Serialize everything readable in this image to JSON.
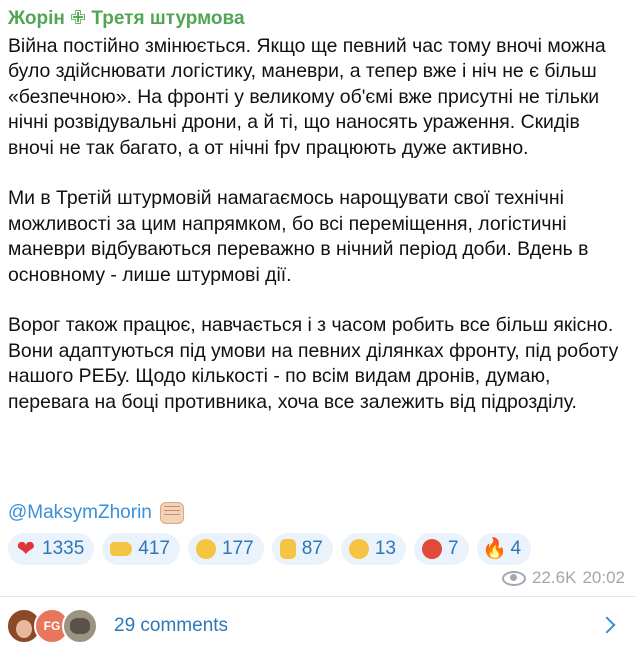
{
  "post": {
    "channel": "Жорін ✙ Третя штурмова",
    "paragraphs": [
      "Війна постійно змінюється. Якщо ще певний час тому вночі можна було здійснювати логістику, маневри, а тепер вже і ніч не є більш «безпечною». На фронті у великому об'ємі вже присутні не тільки нічні розвідувальні дрони, а й ті, що наносять ураження. Скидів вночі не так багато, а от нічні fpv працюють дуже активно.",
      "Ми в Третій штурмовій намагаємось нарощувати свої технічні можливості за цим напрямком, бо всі переміщення, логістичні маневри відбуваються переважно в нічний період доби. Вдень в основному - лише штурмові дії.",
      "Ворог також працює, навчається і з часом робить все більш якісно. Вони адаптуються під умови на певних ділянках фронту, під роботу нашого РЕБу. Щодо кількості - по всім видам дронів, думаю, перевага на боці противника, хоча все залежить від підрозділу."
    ],
    "signature": "@MaksymZhorin",
    "signature_icon": "fist-emoji-icon"
  },
  "reactions": [
    {
      "icon": "heart-emoji-icon",
      "glyph": "❤",
      "count": "1335"
    },
    {
      "icon": "pointing-hand-emoji-icon",
      "glyph": "",
      "count": "417"
    },
    {
      "icon": "crying-face-emoji-icon",
      "glyph": "",
      "count": "177"
    },
    {
      "icon": "thumbs-up-emoji-icon",
      "glyph": "",
      "count": "87"
    },
    {
      "icon": "grinning-face-emoji-icon",
      "glyph": "",
      "count": "13"
    },
    {
      "icon": "angry-face-emoji-icon",
      "glyph": "",
      "count": "7"
    },
    {
      "icon": "fire-emoji-icon",
      "glyph": "🔥",
      "count": "4"
    }
  ],
  "meta": {
    "views": "22.6K",
    "time": "20:02"
  },
  "comments": {
    "avatar_initials": "FG",
    "label": "29 comments"
  },
  "colors": {
    "channel": "#52a653",
    "link": "#3a8fd9",
    "reaction_bg": "#eaf2fb",
    "reaction_text": "#2d77b9",
    "meta": "#a0a7af"
  }
}
